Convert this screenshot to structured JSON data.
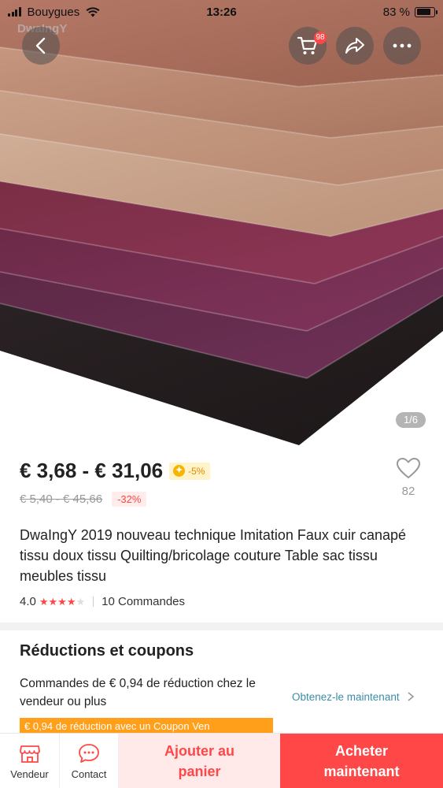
{
  "status_bar": {
    "carrier": "Bouygues",
    "time": "13:26",
    "battery": "83 %",
    "battery_level": 0.83
  },
  "header": {
    "watermark": "DwaIngY",
    "cart_badge": "98",
    "image_counter": "1/6"
  },
  "product": {
    "price": "€ 3,68 - € 31,06",
    "coin_discount": "-5%",
    "old_price": "€ 5,40 - € 45,66",
    "discount": "-32%",
    "wishlist_count": "82",
    "title": "DwaIngY 2019 nouveau technique Imitation Faux cuir canapé tissu doux tissu Quilting/bricolage couture Table sac tissu meubles tissu",
    "rating": "4.0",
    "rating_stars": 4,
    "orders": "10 Commandes"
  },
  "coupons": {
    "heading": "Réductions et coupons",
    "text": "Commandes de € 0,94 de réduction chez le vendeur ou plus",
    "link": "Obtenez-le maintenant",
    "tag": "€ 0,94 de réduction avec un Coupon Ven"
  },
  "bottom_bar": {
    "seller_label": "Vendeur",
    "contact_label": "Contact",
    "add_to_cart": "Ajouter au panier",
    "buy_now": "Acheter maintenant"
  },
  "colors": {
    "accent": "#ff4747",
    "link": "#3a8ea6",
    "coupon": "#ff9f1a"
  },
  "icons": [
    "back-icon",
    "cart-icon",
    "share-icon",
    "more-icon",
    "heart-icon",
    "store-icon",
    "chat-icon",
    "chevron-right-icon"
  ]
}
